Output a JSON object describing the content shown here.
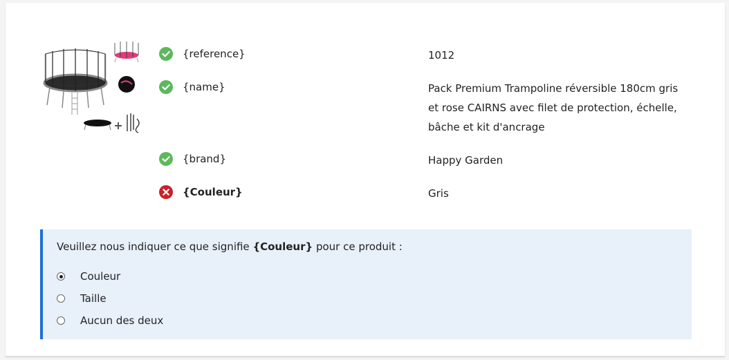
{
  "product": {
    "image_name": "trampoline-product-image",
    "fields": [
      {
        "status": "ok",
        "icon": "check-circle-icon",
        "label": "{reference}",
        "value": "1012"
      },
      {
        "status": "ok",
        "icon": "check-circle-icon",
        "label": "{name}",
        "value": "Pack Premium Trampoline réversible 180cm gris et rose CAIRNS avec filet de protection, échelle, bâche et kit d'ancrage"
      },
      {
        "status": "ok",
        "icon": "check-circle-icon",
        "label": "{brand}",
        "value": "Happy Garden"
      },
      {
        "status": "error",
        "icon": "error-circle-icon",
        "label": "{Couleur}",
        "value": "Gris"
      }
    ]
  },
  "question": {
    "prefix": "Veuillez nous indiquer ce que signifie ",
    "term": "{Couleur}",
    "suffix": " pour ce produit :",
    "options": [
      {
        "label": "Couleur",
        "selected": true
      },
      {
        "label": "Taille",
        "selected": false
      },
      {
        "label": "Aucun des deux",
        "selected": false
      }
    ]
  },
  "colors": {
    "ok": "#5cb85c",
    "error": "#c9202a",
    "accent": "#1a6fd8",
    "question_bg": "#e8f0fa"
  }
}
